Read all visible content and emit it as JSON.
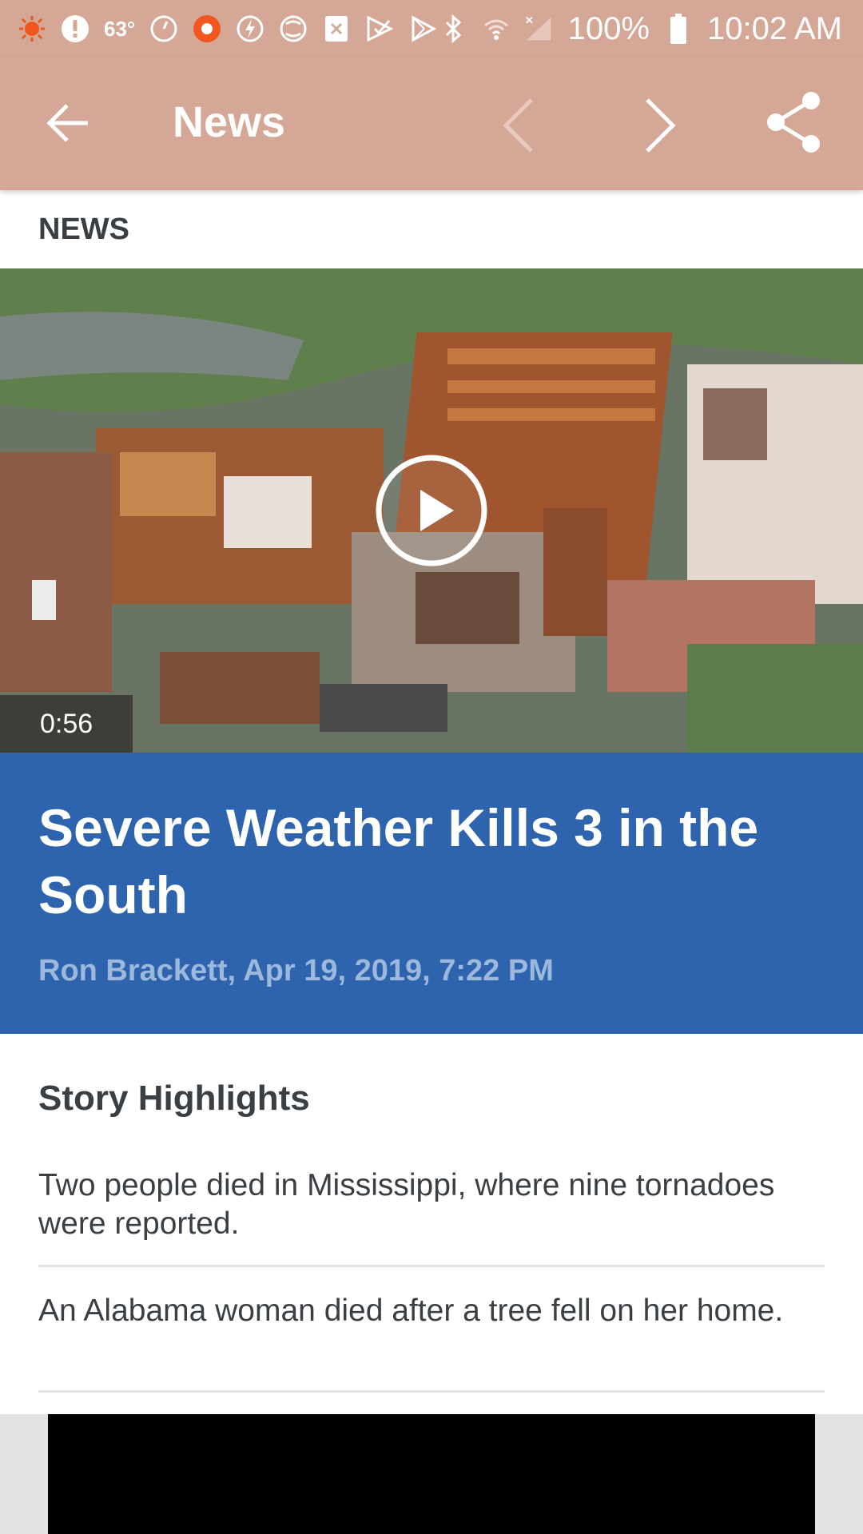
{
  "status_bar": {
    "temperature": "63°",
    "battery": "100%",
    "time": "10:02 AM",
    "icons_left": [
      "sun-icon",
      "alert-icon",
      "clock-icon",
      "sun-alert-icon",
      "flash-icon",
      "spiral-icon",
      "x-box-icon",
      "play-check-icon",
      "play-store-icon"
    ],
    "icons_right": [
      "bluetooth-icon",
      "wifi-icon",
      "signal-icon",
      "battery-icon"
    ]
  },
  "app_bar": {
    "title": "News",
    "colors": {
      "background": "#d4a796"
    }
  },
  "section_label": "NEWS",
  "article": {
    "video_duration": "0:56",
    "headline": "Severe Weather Kills 3 in the South",
    "byline": "Ron Brackett, Apr 19, 2019, 7:22 PM",
    "colors": {
      "headline_bg": "#2d64ad"
    }
  },
  "highlights": {
    "title": "Story Highlights",
    "items": [
      "Two people died in Mississippi, where nine tornadoes were reported.",
      "An Alabama woman died after a tree fell on her home."
    ]
  }
}
